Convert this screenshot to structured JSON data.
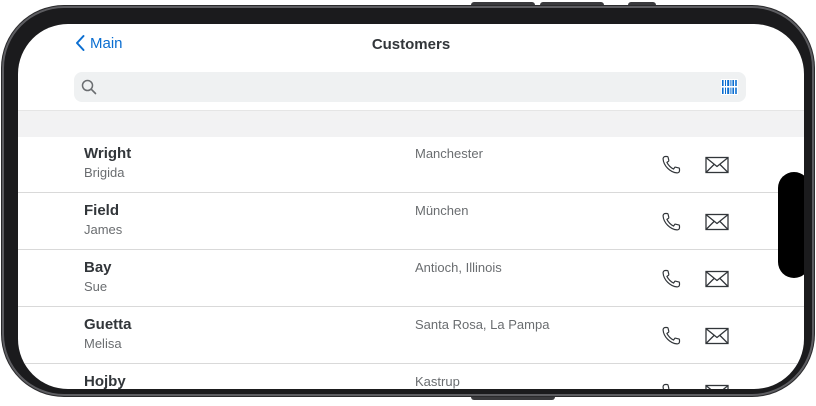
{
  "nav": {
    "back_label": "Main",
    "title": "Customers"
  },
  "search": {
    "placeholder": "",
    "value": ""
  },
  "customers": [
    {
      "last_name": "Wright",
      "first_name": "Brigida",
      "city": "Manchester"
    },
    {
      "last_name": "Field",
      "first_name": "James",
      "city": "München"
    },
    {
      "last_name": "Bay",
      "first_name": "Sue",
      "city": "Antioch, Illinois"
    },
    {
      "last_name": "Guetta",
      "first_name": "Melisa",
      "city": "Santa Rosa, La Pampa"
    },
    {
      "last_name": "Hojby",
      "first_name": "",
      "city": "Kastrup"
    }
  ],
  "icons": {
    "back": "chevron-left-icon",
    "search": "search-icon",
    "barcode": "barcode-scanner-icon",
    "call": "phone-icon",
    "email": "mail-icon"
  },
  "colors": {
    "accent": "#0a6ed1",
    "text": "#32363a",
    "secondary_text": "#6a6d70",
    "band": "#f2f2f3"
  }
}
